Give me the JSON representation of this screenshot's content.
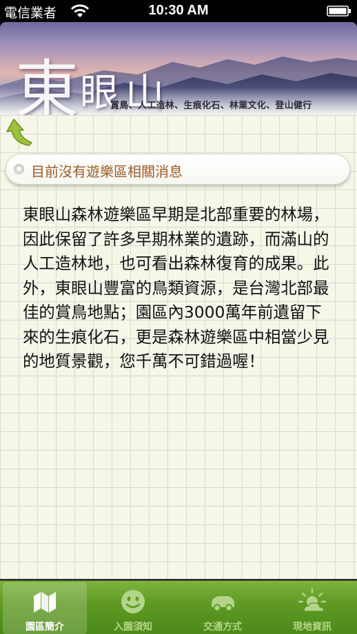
{
  "status_bar": {
    "carrier": "電信業者",
    "time": "10:30 AM",
    "wifi_icon": "wifi-icon",
    "battery_icon": "battery-icon"
  },
  "banner": {
    "title_big": "東",
    "title_rest": "眼山",
    "tagline": "賞鳥、人工造林、生痕化石、林業文化、登山健行"
  },
  "back_icon": "back-arrow-icon",
  "news": {
    "text": "目前沒有遊樂區相關消息"
  },
  "intro": {
    "text": "東眼山森林遊樂區早期是北部重要的林場，因此保留了許多早期林業的遺跡，而滿山的人工造林地，也可看出森林復育的成果。此外，東眼山豐富的鳥類資源，是台灣北部最佳的賞鳥地點；園區內3000萬年前遺留下來的生痕化石，更是森林遊樂區中相當少見的地質景觀，您千萬不可錯過喔！"
  },
  "tabs": [
    {
      "label": "園區簡介",
      "icon": "map-icon",
      "selected": true
    },
    {
      "label": "入園須知",
      "icon": "smiley-icon",
      "selected": false
    },
    {
      "label": "交通方式",
      "icon": "car-icon",
      "selected": false
    },
    {
      "label": "現地資訊",
      "icon": "weather-icon",
      "selected": false
    }
  ],
  "colors": {
    "tab_bar": "#5f9a24",
    "news_text": "#9a5a24",
    "back_arrow": "#9bc23a"
  }
}
